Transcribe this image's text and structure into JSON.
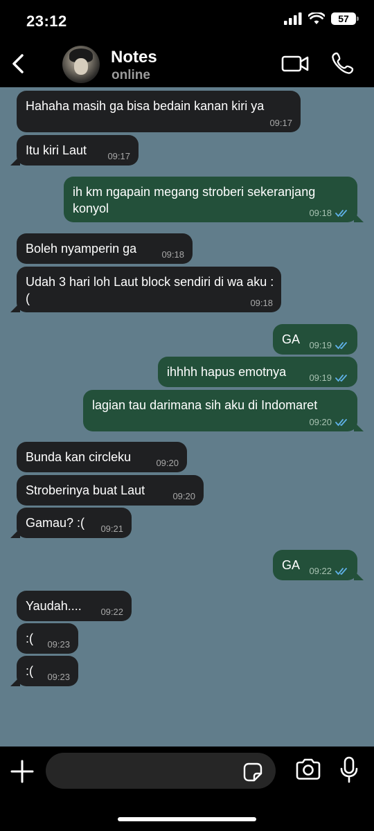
{
  "status_bar": {
    "time": "23:12",
    "battery": "57"
  },
  "header": {
    "contact_name": "Notes",
    "contact_status": "online",
    "icons": [
      "back-chevron-icon",
      "avatar",
      "video-call-icon",
      "phone-icon"
    ]
  },
  "messages": [
    {
      "dir": "in",
      "text": "Hahaha masih ga bisa bedain kanan kiri ya",
      "time": "09:17"
    },
    {
      "dir": "in",
      "text": "Itu kiri Laut",
      "time": "09:17"
    },
    {
      "dir": "out",
      "text": "ih km ngapain megang stroberi sekeranjang konyol",
      "time": "09:18",
      "status": "read"
    },
    {
      "dir": "in",
      "text": "Boleh nyamperin ga",
      "time": "09:18"
    },
    {
      "dir": "in",
      "text": "Udah 3 hari loh Laut block sendiri di wa aku :(",
      "time": "09:18"
    },
    {
      "dir": "out",
      "text": "GA",
      "time": "09:19",
      "status": "read"
    },
    {
      "dir": "out",
      "text": "ihhhh hapus emotnya",
      "time": "09:19",
      "status": "read"
    },
    {
      "dir": "out",
      "text": "lagian tau darimana sih aku di Indomaret",
      "time": "09:20",
      "status": "read"
    },
    {
      "dir": "in",
      "text": "Bunda kan circleku",
      "time": "09:20"
    },
    {
      "dir": "in",
      "text": "Stroberinya buat Laut",
      "time": "09:20"
    },
    {
      "dir": "in",
      "text": "Gamau? :(",
      "time": "09:21"
    },
    {
      "dir": "out",
      "text": "GA",
      "time": "09:22",
      "status": "read"
    },
    {
      "dir": "in",
      "text": "Yaudah....",
      "time": "09:22"
    },
    {
      "dir": "in",
      "text": ":(",
      "time": "09:23"
    },
    {
      "dir": "in",
      "text": ":(",
      "time": "09:23"
    }
  ],
  "input_bar": {
    "message_value": "",
    "icons": [
      "plus-icon",
      "sticker-icon",
      "camera-icon",
      "microphone-icon"
    ]
  },
  "colors": {
    "chat_background": "#617d8b",
    "incoming_bubble": "#1f2022",
    "outgoing_bubble": "#23503a",
    "read_ticks": "#5fb1e8"
  }
}
